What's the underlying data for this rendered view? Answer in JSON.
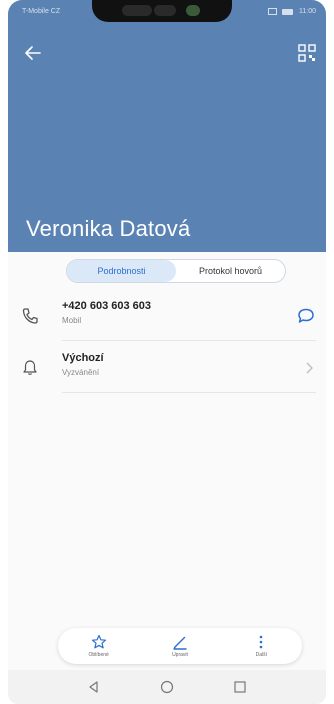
{
  "status_bar": {
    "carrier": "T-Mobile CZ",
    "time": "11:00"
  },
  "header": {
    "contact_name": "Veronika Datová",
    "back_icon": "arrow-left-icon",
    "qr_icon": "qr-code-icon"
  },
  "tabs": [
    {
      "label": "Podrobnosti",
      "active": true
    },
    {
      "label": "Protokol hovorů",
      "active": false
    }
  ],
  "details": {
    "phone": {
      "number": "+420 603 603 603",
      "type": "Mobil",
      "icon": "phone-icon",
      "action_icon": "message-icon"
    },
    "ringtone": {
      "title": "Výchozí",
      "subtitle": "Vyzvánění",
      "icon": "bell-icon",
      "action_icon": "chevron-right-icon"
    }
  },
  "actions": [
    {
      "label": "Oblíbené",
      "icon": "star-icon"
    },
    {
      "label": "Upravit",
      "icon": "pencil-icon"
    },
    {
      "label": "Další",
      "icon": "more-vertical-icon"
    }
  ],
  "nav": [
    "back-triangle-icon",
    "home-circle-icon",
    "recents-square-icon"
  ],
  "colors": {
    "header": "#5a83b3",
    "accent": "#2a6fd1"
  }
}
